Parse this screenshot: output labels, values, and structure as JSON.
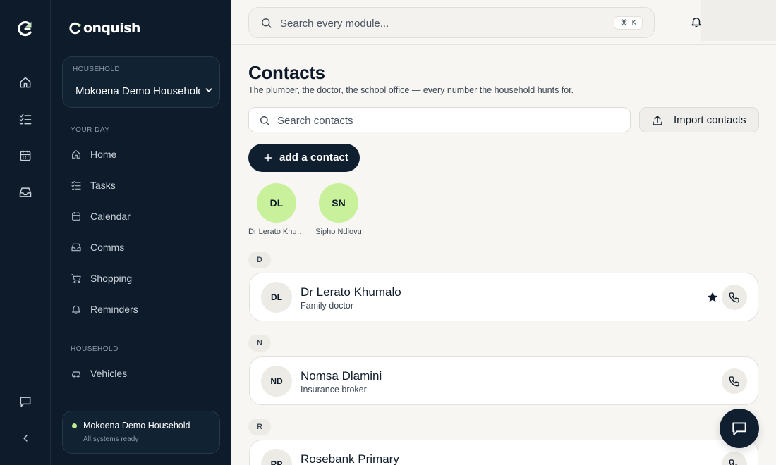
{
  "brand": {
    "name": "onquish",
    "logo_icon": "conquish-logo-icon"
  },
  "household_selector": {
    "label": "HOUSEHOLD",
    "value": "Mokoena Demo Household"
  },
  "sidebar": {
    "sections": [
      {
        "title": "YOUR DAY",
        "items": [
          {
            "label": "Home",
            "icon": "home-icon"
          },
          {
            "label": "Tasks",
            "icon": "checklist-icon"
          },
          {
            "label": "Calendar",
            "icon": "calendar-icon"
          },
          {
            "label": "Comms",
            "icon": "inbox-icon"
          },
          {
            "label": "Shopping",
            "icon": "cart-icon"
          },
          {
            "label": "Reminders",
            "icon": "bell-icon"
          }
        ]
      },
      {
        "title": "HOUSEHOLD",
        "items": [
          {
            "label": "Vehicles",
            "icon": "car-icon"
          }
        ]
      }
    ],
    "status": {
      "title": "Mokoena Demo Household",
      "subtitle": "All systems ready",
      "dot_color": "#b9ef8e"
    }
  },
  "topbar": {
    "search_placeholder": "Search every module...",
    "shortcut_symbol": "⌘",
    "shortcut_key": "K"
  },
  "page": {
    "title": "Contacts",
    "subtitle": "The plumber, the doctor, the school office — every number the household hunts for."
  },
  "contact_search": {
    "placeholder": "Search contacts"
  },
  "actions": {
    "import_label": "Import contacts",
    "add_label": "add a contact"
  },
  "favourites": [
    {
      "initials": "DL",
      "name": "Dr Lerato Khumalo"
    },
    {
      "initials": "SN",
      "name": "Sipho Ndlovu"
    }
  ],
  "groups": [
    {
      "letter": "D",
      "contacts": [
        {
          "initials": "DL",
          "name": "Dr Lerato Khumalo",
          "role": "Family doctor",
          "starred": true
        }
      ]
    },
    {
      "letter": "N",
      "contacts": [
        {
          "initials": "ND",
          "name": "Nomsa Dlamini",
          "role": "Insurance broker",
          "starred": false
        }
      ]
    },
    {
      "letter": "R",
      "contacts": [
        {
          "initials": "RP",
          "name": "Rosebank Primary",
          "role": "",
          "starred": false
        }
      ]
    }
  ],
  "colors": {
    "sidebar_bg": "#0d1b2a",
    "accent_green": "#c9f09b",
    "primary_button": "#0f1f30",
    "notification_badge": "#e23b3b"
  }
}
